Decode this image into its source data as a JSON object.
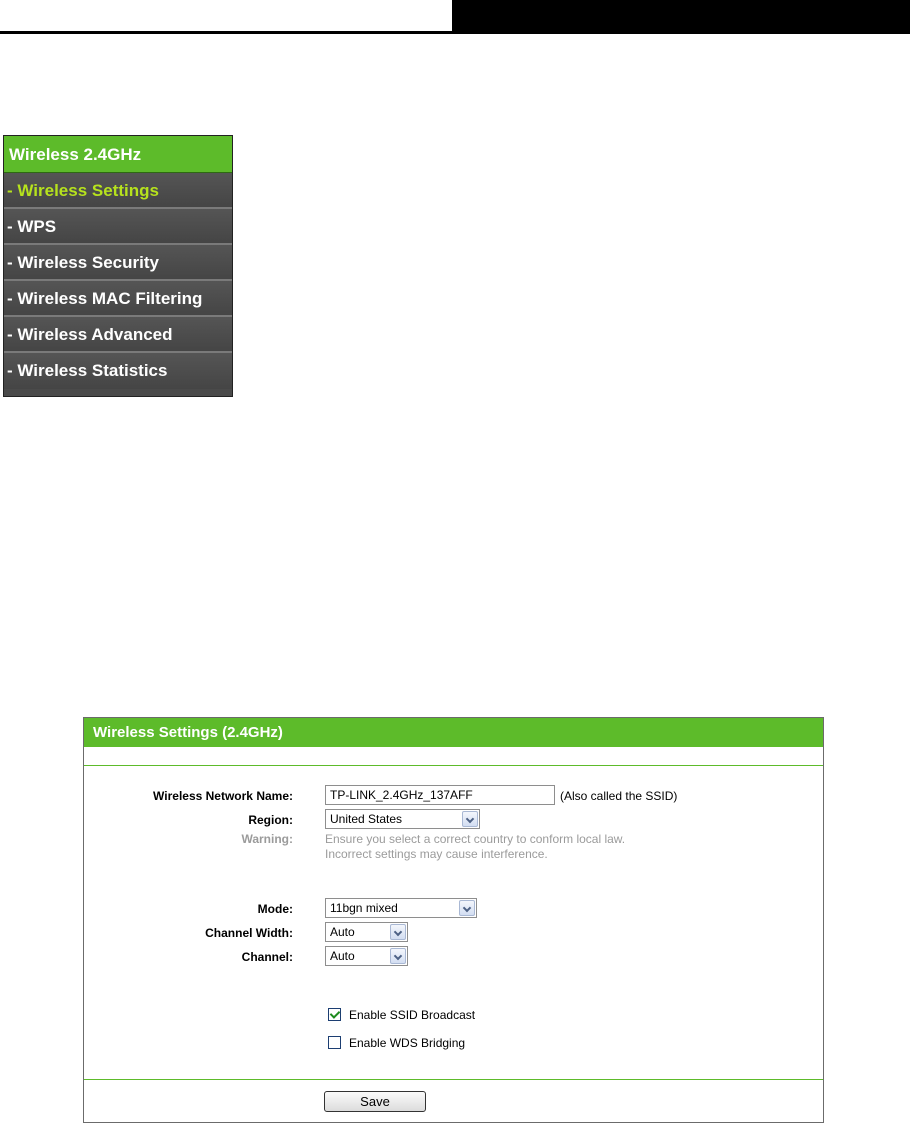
{
  "menu": {
    "title": "Wireless 2.4GHz",
    "items": [
      {
        "label": "- Wireless Settings",
        "active": true
      },
      {
        "label": "- WPS"
      },
      {
        "label": "- Wireless Security"
      },
      {
        "label": "- Wireless MAC Filtering"
      },
      {
        "label": "- Wireless Advanced"
      },
      {
        "label": "- Wireless Statistics"
      }
    ]
  },
  "panel": {
    "title": "Wireless Settings (2.4GHz)",
    "network_name": {
      "label": "Wireless Network Name:",
      "value": "TP-LINK_2.4GHz_137AFF",
      "hint": "(Also called the SSID)"
    },
    "region": {
      "label": "Region:",
      "value": "United States"
    },
    "warning": {
      "label": "Warning:",
      "line1": "Ensure you select a correct country to conform local law.",
      "line2": "Incorrect settings may cause interference."
    },
    "mode": {
      "label": "Mode:",
      "value": "11bgn mixed"
    },
    "channel_width": {
      "label": "Channel Width:",
      "value": "Auto"
    },
    "channel": {
      "label": "Channel:",
      "value": "Auto"
    },
    "ssid_broadcast": {
      "label": "Enable SSID Broadcast",
      "checked": true
    },
    "wds_bridging": {
      "label": "Enable WDS Bridging",
      "checked": false
    },
    "save_label": "Save"
  },
  "colors": {
    "accent_green": "#5dbb2a",
    "active_menu_text": "#b6e21d",
    "menu_background": "#4a4a4a"
  }
}
